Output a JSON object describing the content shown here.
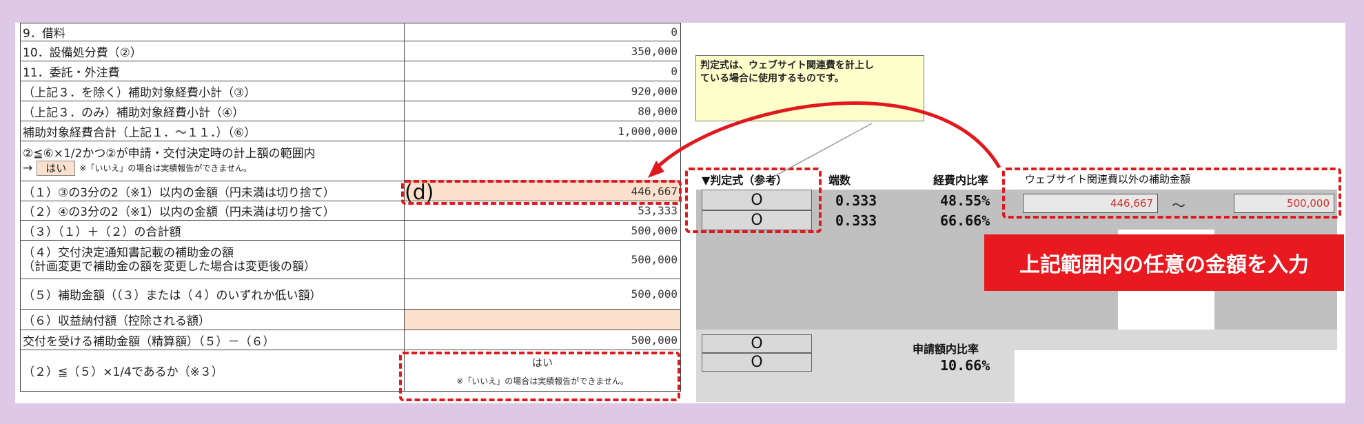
{
  "table": {
    "rows": [
      {
        "label": "9．借料",
        "value": "0"
      },
      {
        "label": "10．設備処分費（②）",
        "value": "350,000"
      },
      {
        "label": "11．委託・外注費",
        "value": "0"
      },
      {
        "label": "（上記３．を除く）補助対象経費小計（③）",
        "value": "920,000"
      },
      {
        "label": "（上記３．のみ）補助対象経費小計（④）",
        "value": "80,000"
      },
      {
        "label": "補助対象経費合計（上記１．～１１．）（⑥）",
        "value": "1,000,000"
      }
    ],
    "condition": {
      "line1": "②≦⑥×1/2かつ②が申請・交付決定時の計上額の範囲内",
      "arrow": "→",
      "answer": "はい",
      "note": "※「いいえ」の場合は実績報告ができません。"
    },
    "row_1": {
      "label": "（１）③の3分の2（※1）以内の金額（円未満は切り捨て）",
      "value": "446,667"
    },
    "row_2": {
      "label": "（２）④の3分の2（※1）以内の金額（円未満は切り捨て）",
      "value": "53,333"
    },
    "row_3": {
      "label": "（３）（１）＋（２）の合計額",
      "value": "500,000"
    },
    "row_4": {
      "line1": "（４）交付決定通知書記載の補助金の額",
      "line2": "（計画変更で補助金の額を変更した場合は変更後の額）",
      "value": "500,000"
    },
    "row_5": {
      "label": "（５）補助金額（（３）または（４）のいずれか低い額）",
      "value": "500,000"
    },
    "row_6": {
      "label": "（６）収益納付額（控除される額）",
      "value": ""
    },
    "row_final": {
      "label": "交付を受ける補助金額（精算額）（５）－（６）",
      "value": "500,000"
    },
    "row_check": {
      "label": "（２）≦（５）×1/4であるか（※３）",
      "answer": "はい",
      "note": "※「いいえ」の場合は実績報告ができません。"
    }
  },
  "note_box": {
    "line1": "判定式は、ウェブサイト関連費を計上し",
    "line2": "ている場合に使用するものです。"
  },
  "judge": {
    "header": "▼判定式（参考）",
    "header_fraction": "端数",
    "header_ratio": "経費内比率",
    "header_amount": "ウェブサイト関連費以外の補助金額",
    "rows": [
      {
        "mark": "O",
        "fraction": "0.333",
        "ratio": "48.55%"
      },
      {
        "mark": "O",
        "fraction": "0.333",
        "ratio": "66.66%"
      }
    ],
    "min_amount": "446,667",
    "tilde": "～",
    "max_amount": "500,000",
    "lower_header": "申請額内比率",
    "lower_rows": [
      {
        "mark": "O"
      },
      {
        "mark": "O",
        "ratio": "10.66%"
      }
    ]
  },
  "annotation": {
    "d_label": "(d)",
    "banner": "上記範囲内の任意の金額を入力"
  }
}
